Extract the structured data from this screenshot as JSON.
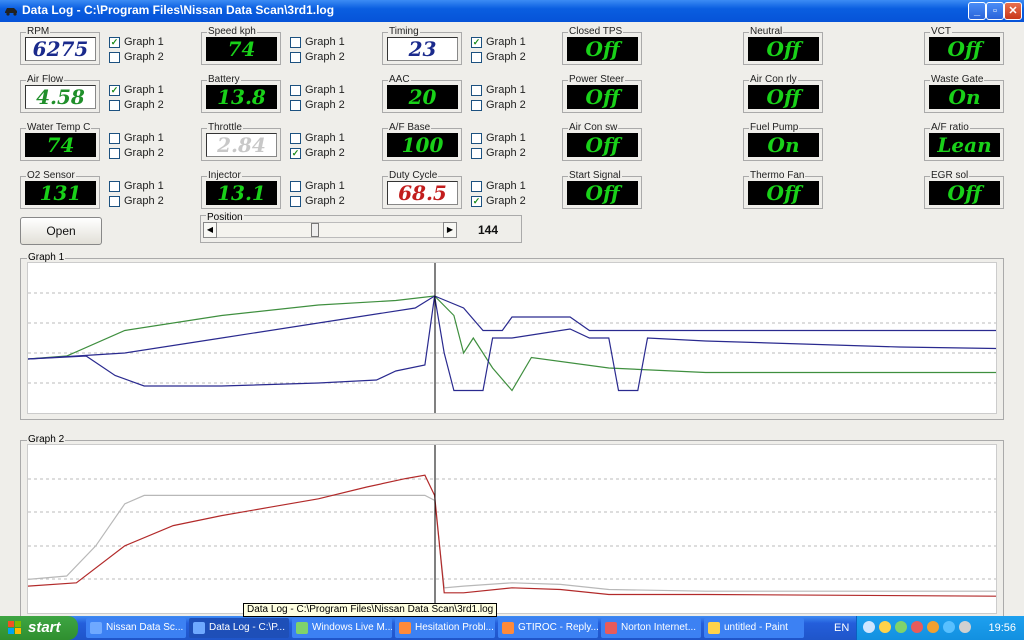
{
  "window": {
    "title": "Data Log - C:\\Program Files\\Nissan Data Scan\\3rd1.log"
  },
  "checkbox_labels": {
    "g1": "Graph 1",
    "g2": "Graph 2"
  },
  "gauges": [
    {
      "label": "RPM",
      "value": "6275",
      "style": "white",
      "g1": true,
      "g2": false
    },
    {
      "label": "Air Flow",
      "value": "4.58",
      "style": "white-green",
      "g1": true,
      "g2": false
    },
    {
      "label": "Water Temp C",
      "value": "74",
      "style": "black",
      "g1": false,
      "g2": false
    },
    {
      "label": "O2 Sensor",
      "value": "131",
      "style": "black",
      "g1": false,
      "g2": false
    },
    {
      "label": "Speed kph",
      "value": "74",
      "style": "black",
      "g1": false,
      "g2": false
    },
    {
      "label": "Battery",
      "value": "13.8",
      "style": "black",
      "g1": false,
      "g2": false
    },
    {
      "label": "Throttle",
      "value": "2.84",
      "style": "white-dim",
      "g1": false,
      "g2": true
    },
    {
      "label": "Injector",
      "value": "13.1",
      "style": "black",
      "g1": false,
      "g2": false
    },
    {
      "label": "Timing",
      "value": "23",
      "style": "white",
      "g1": true,
      "g2": false
    },
    {
      "label": "AAC",
      "value": "20",
      "style": "black",
      "g1": false,
      "g2": false
    },
    {
      "label": "A/F Base",
      "value": "100",
      "style": "black",
      "g1": false,
      "g2": false
    },
    {
      "label": "Duty Cycle",
      "value": "68.5",
      "style": "white-red",
      "g1": false,
      "g2": true
    }
  ],
  "switches": [
    {
      "label": "Closed TPS",
      "value": "Off"
    },
    {
      "label": "Power Steer",
      "value": "Off"
    },
    {
      "label": "Air Con sw",
      "value": "Off"
    },
    {
      "label": "Start Signal",
      "value": "Off"
    },
    {
      "label": "Neutral",
      "value": "Off"
    },
    {
      "label": "Air Con rly",
      "value": "Off"
    },
    {
      "label": "Fuel Pump",
      "value": "On"
    },
    {
      "label": "Thermo Fan",
      "value": "Off"
    },
    {
      "label": "VCT",
      "value": "Off"
    },
    {
      "label": "Waste Gate",
      "value": "On"
    },
    {
      "label": "A/F ratio",
      "value": "Lean"
    },
    {
      "label": "EGR sol",
      "value": "Off"
    }
  ],
  "controls": {
    "open_label": "Open",
    "position_label": "Position",
    "position_value": "144",
    "position_fraction": 0.43
  },
  "graph1": {
    "label": "Graph 1",
    "cursor_fraction": 0.42
  },
  "graph2": {
    "label": "Graph 2",
    "cursor_fraction": 0.42
  },
  "colors": {
    "series_green": "#3f8f3f",
    "series_blue": "#2a2a8f",
    "series_red": "#b22a2a",
    "series_gray": "#b8b8b8",
    "lcd_green": "#19d119"
  },
  "taskbar": {
    "start_label": "start",
    "tasks": [
      "Nissan Data Sc...",
      "Data Log - C:\\P...",
      "Windows Live M...",
      "Hesitation Probl...",
      "GTIROC - Reply...",
      "Norton Internet...",
      "untitled - Paint"
    ],
    "lang": "EN",
    "clock": "19:56"
  },
  "tooltip": "Data Log - C:\\Program Files\\Nissan Data Scan\\3rd1.log"
}
